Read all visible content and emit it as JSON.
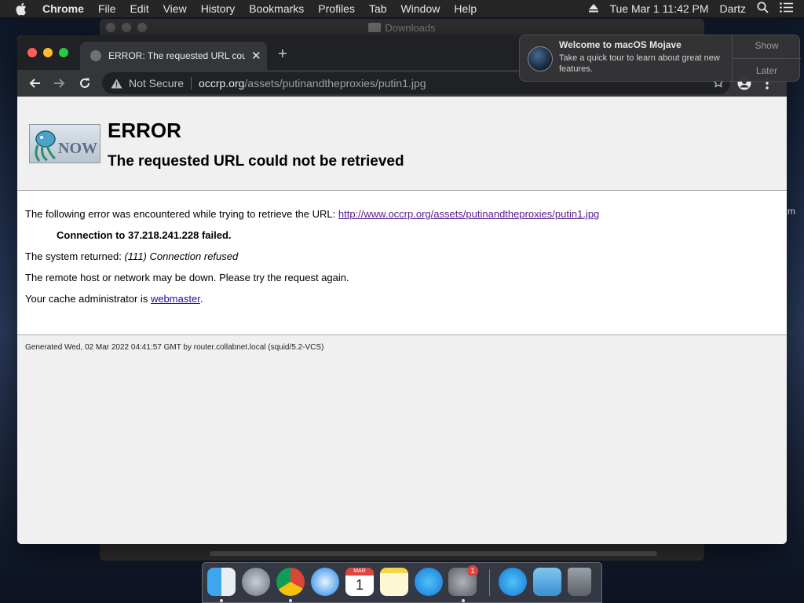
{
  "menubar": {
    "app_name": "Chrome",
    "items": [
      "File",
      "Edit",
      "View",
      "History",
      "Bookmarks",
      "Profiles",
      "Tab",
      "Window",
      "Help"
    ],
    "clock": "Tue Mar 1  11:42 PM",
    "user": "Dartz"
  },
  "background_window": {
    "title": "Downloads"
  },
  "browser": {
    "tab_title": "ERROR: The requested URL could not be retrieved",
    "omnibox": {
      "security_label": "Not Secure",
      "host": "occrp.org",
      "path": "/assets/putinandtheproxies/putin1.jpg"
    }
  },
  "page": {
    "logo_text": "NOW",
    "title": "ERROR",
    "subtitle": "The requested URL could not be retrieved",
    "intro_text": "The following error was encountered while trying to retrieve the URL: ",
    "url_link": "http://www.occrp.org/assets/putinandtheproxies/putin1.jpg",
    "connection_error": "Connection to 37.218.241.228 failed.",
    "system_returned_label": "The system returned: ",
    "system_returned_value": "(111) Connection refused",
    "remote_host_text": "The remote host or network may be down. Please try the request again.",
    "cache_admin_text": "Your cache administrator is ",
    "cache_admin_link": "webmaster",
    "cache_admin_end": ".",
    "footer": "Generated Wed, 02 Mar 2022 04:41:57 GMT by router.collabnet.local (squid/5.2-VCS)"
  },
  "notification": {
    "title": "Welcome to macOS Mojave",
    "body": "Take a quick tour to learn about great new features.",
    "show_label": "Show",
    "later_label": "Later"
  },
  "calendar": {
    "month": "MAR",
    "day": "1"
  },
  "dock": {
    "apps": [
      "finder-icon",
      "launchpad-icon",
      "chrome-icon",
      "safari-icon",
      "calendar-icon",
      "notes-icon",
      "app-store-icon",
      "system-preferences-icon",
      "app-store-installer-icon",
      "downloads-folder-icon",
      "trash-icon"
    ],
    "badge_count": "1"
  },
  "colors": {
    "link": "#1a0dab",
    "visited_link": "#551a8b",
    "close_red": "#ff5f57",
    "minimize_yellow": "#febc2e",
    "zoom_green": "#28c840"
  }
}
